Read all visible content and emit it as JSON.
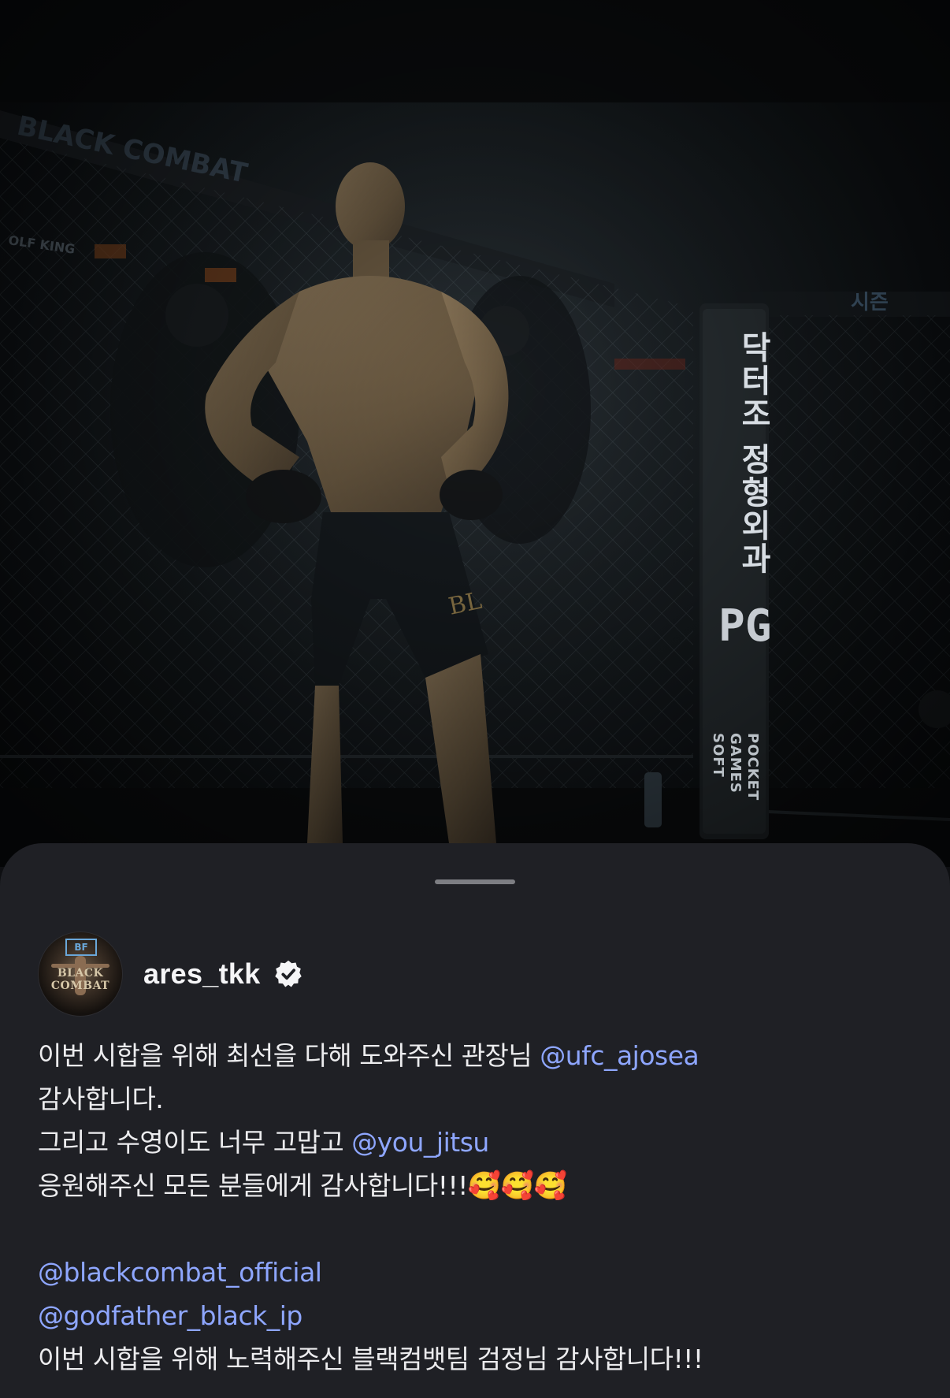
{
  "post": {
    "username": "ares_tkk",
    "verified": true,
    "avatar_text": "BLACK COMBAT",
    "avatar_logo": "BF"
  },
  "photo": {
    "cage_pad_text": "닥터조 정형외과",
    "cage_pad_logo": "PG",
    "cage_pad_brand": [
      "POCKET",
      "GAMES",
      "SOFT"
    ],
    "shorts_brand": "BL"
  },
  "caption": {
    "line1_text": "이번 시합을 위해 최선을 다해 도와주신 관장님 ",
    "line1_mention": "@ufc_ajosea",
    "line2_text": "감사합니다.",
    "line3_text": "그리고 수영이도 너무 고맙고 ",
    "line3_mention": "@you_jitsu",
    "line4_text": "응원해주신 모든 분들에게 감사합니다!!!",
    "line4_emoji": "🥰🥰🥰",
    "mention_a": "@blackcombat_official",
    "mention_b": "@godfather_black_ip",
    "line_last": "이번 시합을 위해 노력해주신 블랙컴뱃팀 검정님 감사합니다!!!"
  },
  "colors": {
    "sheet_background": "#1f2025",
    "mention": "#8ea6ff",
    "text": "#ececee"
  },
  "icons": {
    "verified": "verified-badge-icon"
  }
}
